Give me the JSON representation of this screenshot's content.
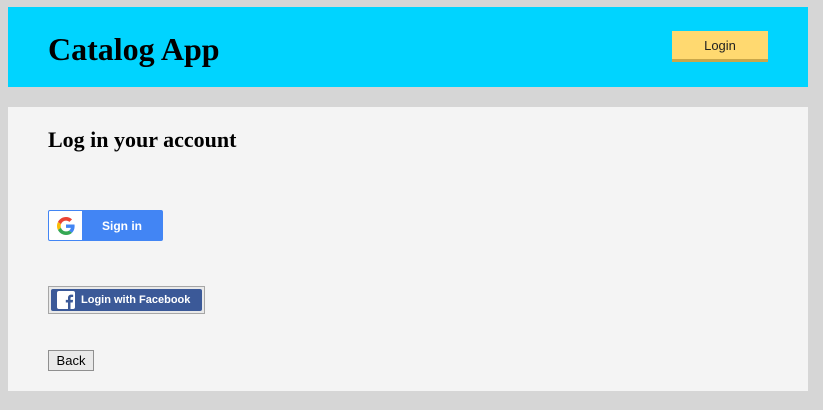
{
  "header": {
    "title": "Catalog App",
    "login_label": "Login"
  },
  "main": {
    "heading": "Log in your account",
    "google_button_label": "Sign in",
    "facebook_button_label": "Login with Facebook",
    "back_button_label": "Back"
  },
  "colors": {
    "header_bg": "#00d4ff",
    "login_button_bg": "#ffd970",
    "google_blue": "#4285f4",
    "facebook_blue": "#3b5998"
  },
  "icons": {
    "google": "google-g-logo",
    "facebook": "facebook-f-logo"
  }
}
